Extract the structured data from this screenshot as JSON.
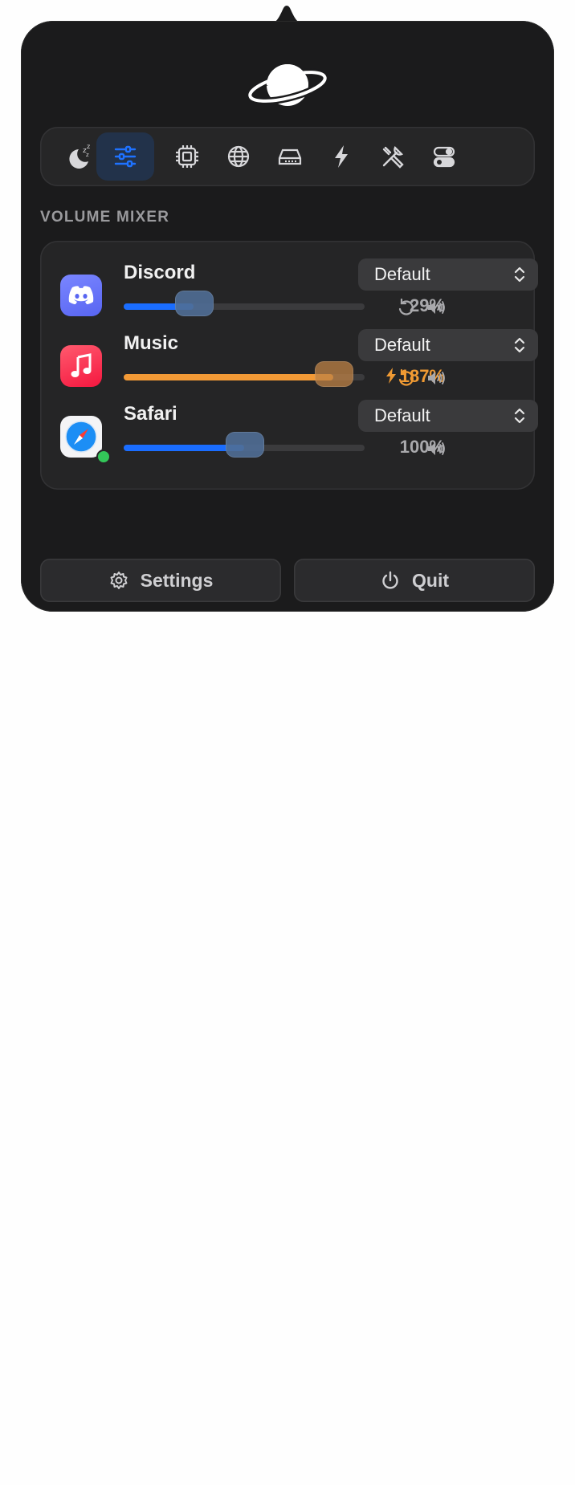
{
  "section_title": "VOLUME MIXER",
  "toolbar": {
    "tools": [
      {
        "icon": "moon-sleep-icon",
        "active": false
      },
      {
        "icon": "sliders-icon",
        "active": true
      },
      {
        "icon": "cpu-chip-icon",
        "active": false
      },
      {
        "icon": "globe-icon",
        "active": false
      },
      {
        "icon": "drive-icon",
        "active": false
      },
      {
        "icon": "bolt-icon",
        "active": false
      },
      {
        "icon": "tools-icon",
        "active": false
      },
      {
        "icon": "toggles-icon",
        "active": false
      }
    ]
  },
  "apps": [
    {
      "name": "Discord",
      "device": "Default",
      "volume_text": "29%",
      "volume_fraction": 0.29,
      "boosted": false,
      "has_reset": true,
      "accent": "#1a6dff",
      "active_indicator": false
    },
    {
      "name": "Music",
      "device": "Default",
      "volume_text": "187%",
      "volume_fraction": 0.87,
      "boosted": true,
      "has_reset": true,
      "accent": "#f39a36",
      "active_indicator": false
    },
    {
      "name": "Safari",
      "device": "Default",
      "volume_text": "100%",
      "volume_fraction": 0.5,
      "boosted": false,
      "has_reset": false,
      "accent": "#1a6dff",
      "active_indicator": true
    }
  ],
  "buttons": {
    "settings_label": "Settings",
    "quit_label": "Quit"
  },
  "colors": {
    "panel_bg": "#1b1b1c",
    "active_tool": "#1e72ff",
    "boost": "#f09a33"
  }
}
